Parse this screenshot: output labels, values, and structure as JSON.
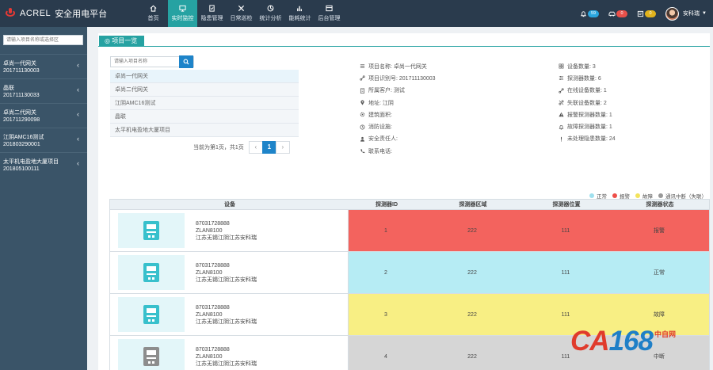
{
  "brand": {
    "name": "ACREL",
    "subtitle": "安全用电平台"
  },
  "nav": [
    {
      "label": "首页",
      "icon": "home-icon"
    },
    {
      "label": "实时监控",
      "icon": "monitor-icon",
      "active": true
    },
    {
      "label": "隐患管理",
      "icon": "hazard-icon"
    },
    {
      "label": "日常巡检",
      "icon": "inspection-icon"
    },
    {
      "label": "统计分析",
      "icon": "analysis-icon"
    },
    {
      "label": "能耗统计",
      "icon": "energy-icon"
    },
    {
      "label": "后台管理",
      "icon": "admin-icon"
    }
  ],
  "topRight": {
    "bellCount": "59",
    "carCount": "0",
    "msgCount": "0",
    "username": "安科瑞"
  },
  "sidebar": {
    "searchPlaceholder": "请输入项目名称或选择区",
    "items": [
      {
        "name": "卓尚一代网关",
        "code": "201711130003"
      },
      {
        "name": "晶联",
        "code": "201711130033"
      },
      {
        "name": "卓尚二代网关",
        "code": "201711290098"
      },
      {
        "name": "江阴AMC16测试",
        "code": "201803290001"
      },
      {
        "name": "太平机电盈地大厦项目",
        "code": "201805100111"
      }
    ]
  },
  "panel": {
    "title": "项目一览",
    "searchPlaceholder": "请输入项目名称",
    "projects": [
      "卓尚一代网关",
      "卓尚二代网关",
      "江阴AMC16测试",
      "晶联",
      "太平机电盈地大厦项目"
    ],
    "pagerText": "当前为第1页，共1页",
    "prev": "‹",
    "page": "1",
    "next": "›"
  },
  "info": {
    "left": [
      {
        "icon": "list-icon",
        "text": "项目名称: 卓尚一代网关"
      },
      {
        "icon": "link-icon",
        "text": "项目识别号: 201711130003"
      },
      {
        "icon": "building-icon",
        "text": "所属客户: 测试"
      },
      {
        "icon": "location-icon",
        "text": "地址: 江阴"
      },
      {
        "icon": "gear-icon",
        "text": "建筑面积:"
      },
      {
        "icon": "fire-icon",
        "text": "消防设施:"
      },
      {
        "icon": "person-icon",
        "text": "安全责任人:"
      },
      {
        "icon": "phone-icon",
        "text": "联系电话:"
      }
    ],
    "right": [
      {
        "icon": "grid-icon",
        "text": "设备数量: 3"
      },
      {
        "icon": "sliders-icon",
        "text": "探测器数量: 6"
      },
      {
        "icon": "link-icon",
        "text": "在线设备数量: 1"
      },
      {
        "icon": "unlink-icon",
        "text": "失联设备数量: 2"
      },
      {
        "icon": "warning-icon",
        "text": "报警探测器数量: 1"
      },
      {
        "icon": "bell-icon",
        "text": "故障探测器数量: 1"
      },
      {
        "icon": "exclamation-icon",
        "text": "未处理隐患数量: 24"
      }
    ]
  },
  "legend": [
    {
      "label": "正常",
      "color": "#9fe0ee"
    },
    {
      "label": "报警",
      "color": "#ee4f49"
    },
    {
      "label": "故障",
      "color": "#f3e35c"
    },
    {
      "label": "通讯中断（失联）",
      "color": "#999999"
    }
  ],
  "table": {
    "headers": [
      "设备",
      "探测器ID",
      "探测器区域",
      "探测器位置",
      "探测器状态"
    ],
    "rows": [
      {
        "line1": "87031728888",
        "line2": "ZLAN8100",
        "line3": "江苏无锡江阴江苏安科瑞",
        "id": "1",
        "area": "222",
        "position": "111",
        "status": "报警",
        "state": "alarm"
      },
      {
        "line1": "87031728888",
        "line2": "ZLAN8100",
        "line3": "江苏无锡江阴江苏安科瑞",
        "id": "2",
        "area": "222",
        "position": "111",
        "status": "正常",
        "state": "normal"
      },
      {
        "line1": "87031728888",
        "line2": "ZLAN8100",
        "line3": "江苏无锡江阴江苏安科瑞",
        "id": "3",
        "area": "222",
        "position": "111",
        "status": "故障",
        "state": "fault"
      },
      {
        "line1": "87031728888",
        "line2": "ZLAN8100",
        "line3": "江苏无锡江阴江苏安科瑞",
        "id": "4",
        "area": "222",
        "position": "111",
        "status": "中断",
        "state": "offline"
      }
    ]
  },
  "watermark": {
    "part1": "CA",
    "part2": "168",
    "suffix": "中自网"
  },
  "colors": {
    "topbar": "#2a3b4d",
    "accent": "#26a2a2",
    "sidebar": "#3a5468",
    "primary": "#1e84c9",
    "alarm": "#f3635e",
    "normal": "#b6ecf4",
    "fault": "#f8ef84",
    "offline": "#d6d6d6"
  }
}
